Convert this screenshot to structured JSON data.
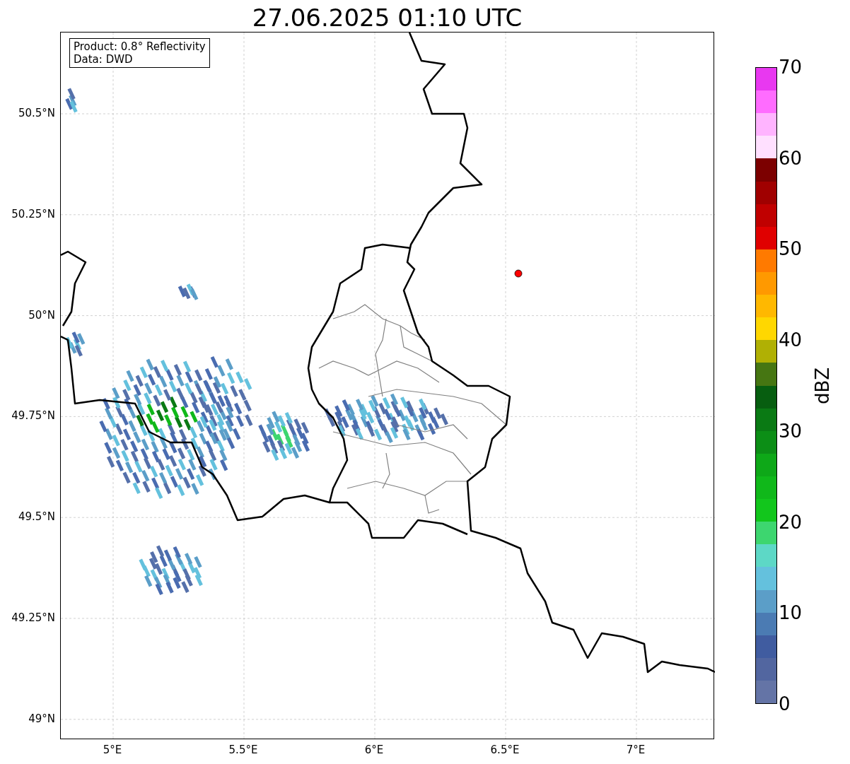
{
  "title": "27.06.2025 01:10 UTC",
  "legend": {
    "lines": [
      "Product: 0.8° Reflectivity",
      "Data: DWD"
    ]
  },
  "map": {
    "lat_labels": [
      "50.5°N",
      "50.25°N",
      "50°N",
      "49.75°N",
      "49.5°N",
      "49.25°N",
      "49°N"
    ],
    "lon_labels": [
      "5°E",
      "5.5°E",
      "6°E",
      "6.5°E",
      "7°E"
    ]
  },
  "colorbar": {
    "label": "dBZ",
    "ticks": [
      "70",
      "60",
      "50",
      "40",
      "30",
      "20",
      "10",
      "0"
    ],
    "bins": [
      {
        "color": "#e838f0"
      },
      {
        "color": "#ff6cff"
      },
      {
        "color": "#ffb4ff"
      },
      {
        "color": "#ffe0ff"
      },
      {
        "color": "#7c0000"
      },
      {
        "color": "#a00000"
      },
      {
        "color": "#c00000"
      },
      {
        "color": "#e00000"
      },
      {
        "color": "#ff7a00"
      },
      {
        "color": "#ff9900"
      },
      {
        "color": "#ffb800"
      },
      {
        "color": "#ffd700"
      },
      {
        "color": "#b0b004"
      },
      {
        "color": "#467612"
      },
      {
        "color": "#075e10"
      },
      {
        "color": "#0a7a14"
      },
      {
        "color": "#0c8e16"
      },
      {
        "color": "#0ea818"
      },
      {
        "color": "#10b81a"
      },
      {
        "color": "#12c61c"
      },
      {
        "color": "#3dd66f"
      },
      {
        "color": "#5dd8c6"
      },
      {
        "color": "#64c1dd"
      },
      {
        "color": "#5b9ec8"
      },
      {
        "color": "#4b7bb3"
      },
      {
        "color": "#405ca0"
      },
      {
        "color": "#5266a0"
      },
      {
        "color": "#6474a6"
      }
    ]
  }
}
